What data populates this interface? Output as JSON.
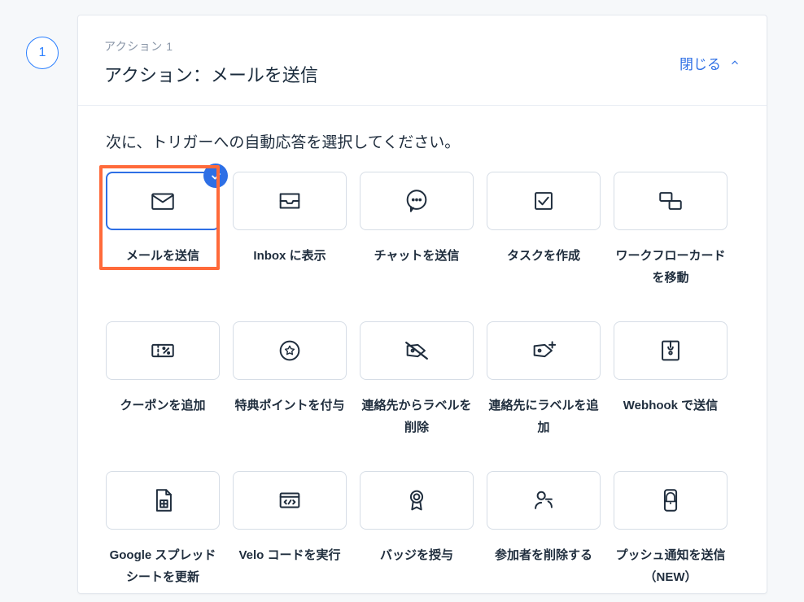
{
  "step": {
    "number": "1"
  },
  "header": {
    "eyebrow": "アクション 1",
    "title": "アクション：メールを送信",
    "close_label": "閉じる"
  },
  "prompt": "次に、トリガーへの自動応答を選択してください。",
  "options": [
    {
      "label": "メールを送信",
      "selected": true,
      "highlight": true,
      "icon": "mail-icon"
    },
    {
      "label": "Inbox に表示",
      "selected": false,
      "highlight": false,
      "icon": "inbox-icon"
    },
    {
      "label": "チャットを送信",
      "selected": false,
      "highlight": false,
      "icon": "chat-icon"
    },
    {
      "label": "タスクを作成",
      "selected": false,
      "highlight": false,
      "icon": "task-icon"
    },
    {
      "label": "ワークフローカードを移動",
      "selected": false,
      "highlight": false,
      "icon": "workflow-icon"
    },
    {
      "label": "クーポンを追加",
      "selected": false,
      "highlight": false,
      "icon": "coupon-icon"
    },
    {
      "label": "特典ポイントを付与",
      "selected": false,
      "highlight": false,
      "icon": "points-icon"
    },
    {
      "label": "連絡先からラベルを削除",
      "selected": false,
      "highlight": false,
      "icon": "label-remove-icon"
    },
    {
      "label": "連絡先にラベルを追加",
      "selected": false,
      "highlight": false,
      "icon": "label-add-icon"
    },
    {
      "label": "Webhook で送信",
      "selected": false,
      "highlight": false,
      "icon": "webhook-icon"
    },
    {
      "label": "Google スプレッドシートを更新",
      "selected": false,
      "highlight": false,
      "icon": "sheets-icon"
    },
    {
      "label": "Velo コードを実行",
      "selected": false,
      "highlight": false,
      "icon": "code-icon"
    },
    {
      "label": "バッジを授与",
      "selected": false,
      "highlight": false,
      "icon": "badge-icon"
    },
    {
      "label": "参加者を削除する",
      "selected": false,
      "highlight": false,
      "icon": "person-remove-icon"
    },
    {
      "label": "プッシュ通知を送信（NEW）",
      "selected": false,
      "highlight": false,
      "icon": "push-icon"
    }
  ]
}
